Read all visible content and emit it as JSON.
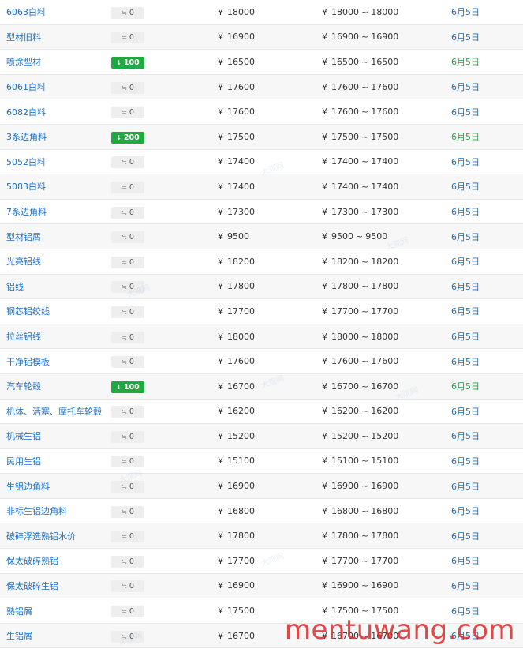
{
  "currency": "¥",
  "range_sep": "~",
  "flat_icon": "≒",
  "up_icon": "↓",
  "watermark_text": "mentuwang.com",
  "wm_text": "大观网",
  "colors": {
    "link": "#1b6fc7",
    "up": "#1fa93f",
    "flat_badge": "#eeeeee",
    "watermark": "#dc2828"
  },
  "rows": [
    {
      "name": "6063白料",
      "change": "0",
      "up": false,
      "price": "18000",
      "low": "18000",
      "high": "18000",
      "date": "6月5日"
    },
    {
      "name": "型材旧料",
      "change": "0",
      "up": false,
      "price": "16900",
      "low": "16900",
      "high": "16900",
      "date": "6月5日"
    },
    {
      "name": "喷涂型材",
      "change": "100",
      "up": true,
      "price": "16500",
      "low": "16500",
      "high": "16500",
      "date": "6月5日"
    },
    {
      "name": "6061白料",
      "change": "0",
      "up": false,
      "price": "17600",
      "low": "17600",
      "high": "17600",
      "date": "6月5日"
    },
    {
      "name": "6082白料",
      "change": "0",
      "up": false,
      "price": "17600",
      "low": "17600",
      "high": "17600",
      "date": "6月5日"
    },
    {
      "name": "3系边角料",
      "change": "200",
      "up": true,
      "price": "17500",
      "low": "17500",
      "high": "17500",
      "date": "6月5日"
    },
    {
      "name": "5052白料",
      "change": "0",
      "up": false,
      "price": "17400",
      "low": "17400",
      "high": "17400",
      "date": "6月5日"
    },
    {
      "name": "5083白料",
      "change": "0",
      "up": false,
      "price": "17400",
      "low": "17400",
      "high": "17400",
      "date": "6月5日"
    },
    {
      "name": "7系边角料",
      "change": "0",
      "up": false,
      "price": "17300",
      "low": "17300",
      "high": "17300",
      "date": "6月5日"
    },
    {
      "name": "型材铝屑",
      "change": "0",
      "up": false,
      "price": "9500",
      "low": "9500",
      "high": "9500",
      "date": "6月5日"
    },
    {
      "name": "光亮铝线",
      "change": "0",
      "up": false,
      "price": "18200",
      "low": "18200",
      "high": "18200",
      "date": "6月5日"
    },
    {
      "name": "铝线",
      "change": "0",
      "up": false,
      "price": "17800",
      "low": "17800",
      "high": "17800",
      "date": "6月5日"
    },
    {
      "name": "钢芯铝绞线",
      "change": "0",
      "up": false,
      "price": "17700",
      "low": "17700",
      "high": "17700",
      "date": "6月5日"
    },
    {
      "name": "拉丝铝线",
      "change": "0",
      "up": false,
      "price": "18000",
      "low": "18000",
      "high": "18000",
      "date": "6月5日"
    },
    {
      "name": "干净铝模板",
      "change": "0",
      "up": false,
      "price": "17600",
      "low": "17600",
      "high": "17600",
      "date": "6月5日"
    },
    {
      "name": "汽车轮毂",
      "change": "100",
      "up": true,
      "price": "16700",
      "low": "16700",
      "high": "16700",
      "date": "6月5日"
    },
    {
      "name": "机体、活塞、摩托车轮毂",
      "change": "0",
      "up": false,
      "price": "16200",
      "low": "16200",
      "high": "16200",
      "date": "6月5日"
    },
    {
      "name": "机械生铝",
      "change": "0",
      "up": false,
      "price": "15200",
      "low": "15200",
      "high": "15200",
      "date": "6月5日"
    },
    {
      "name": "民用生铝",
      "change": "0",
      "up": false,
      "price": "15100",
      "low": "15100",
      "high": "15100",
      "date": "6月5日"
    },
    {
      "name": "生铝边角料",
      "change": "0",
      "up": false,
      "price": "16900",
      "low": "16900",
      "high": "16900",
      "date": "6月5日"
    },
    {
      "name": "非标生铝边角料",
      "change": "0",
      "up": false,
      "price": "16800",
      "low": "16800",
      "high": "16800",
      "date": "6月5日"
    },
    {
      "name": "破碎浮选熟铝水价",
      "change": "0",
      "up": false,
      "price": "17800",
      "low": "17800",
      "high": "17800",
      "date": "6月5日"
    },
    {
      "name": "保太破碎熟铝",
      "change": "0",
      "up": false,
      "price": "17700",
      "low": "17700",
      "high": "17700",
      "date": "6月5日"
    },
    {
      "name": "保太破碎生铝",
      "change": "0",
      "up": false,
      "price": "16900",
      "low": "16900",
      "high": "16900",
      "date": "6月5日"
    },
    {
      "name": "熟铝屑",
      "change": "0",
      "up": false,
      "price": "17500",
      "low": "17500",
      "high": "17500",
      "date": "6月5日"
    },
    {
      "name": "生铝屑",
      "change": "0",
      "up": false,
      "price": "16700",
      "low": "16700",
      "high": "16700",
      "date": "6月5日"
    }
  ]
}
